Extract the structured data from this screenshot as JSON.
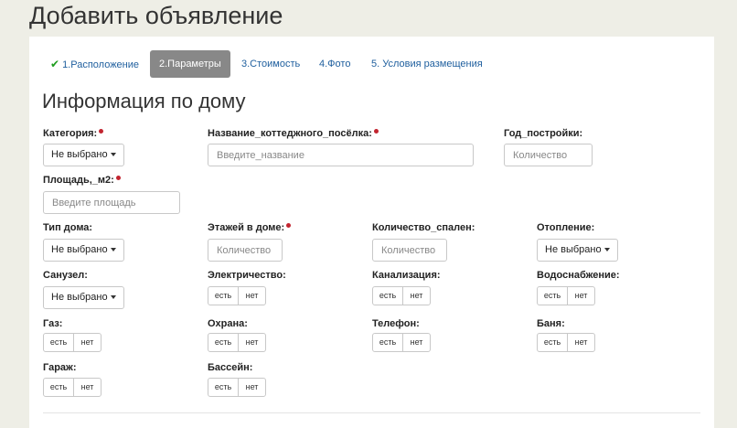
{
  "page_title": "Добавить объявление",
  "tabs": [
    {
      "label": "1.Расположение",
      "done": true
    },
    {
      "label": "2.Параметры",
      "active": true
    },
    {
      "label": "3.Стоимость"
    },
    {
      "label": "4.Фото"
    },
    {
      "label": "5. Условия размещения"
    }
  ],
  "section_title": "Информация по дому",
  "toggle": {
    "yes": "есть",
    "no": "нет"
  },
  "fields": {
    "category": {
      "label": "Категория:",
      "required": true,
      "value": "Не выбрано"
    },
    "settlement_name": {
      "label": "Название_коттеджного_посёлка:",
      "required": true,
      "placeholder": "Введите_название"
    },
    "build_year": {
      "label": "Год_постройки:",
      "placeholder": "Количество"
    },
    "area": {
      "label": "Площадь,_м2:",
      "required": true,
      "placeholder": "Введите площадь"
    },
    "house_type": {
      "label": "Тип дома:",
      "value": "Не выбрано"
    },
    "floors": {
      "label": "Этажей в доме:",
      "required": true,
      "placeholder": "Количество"
    },
    "bedrooms": {
      "label": "Количество_спален:",
      "placeholder": "Количество"
    },
    "heating": {
      "label": "Отопление:",
      "value": "Не выбрано"
    },
    "bathroom": {
      "label": "Санузел:",
      "value": "Не выбрано"
    },
    "electricity": {
      "label": "Электричество:"
    },
    "sewerage": {
      "label": "Канализация:"
    },
    "water": {
      "label": "Водоснабжение:"
    },
    "gas": {
      "label": "Газ:"
    },
    "security": {
      "label": "Охрана:"
    },
    "phone": {
      "label": "Телефон:"
    },
    "sauna": {
      "label": "Баня:"
    },
    "garage": {
      "label": "Гараж:"
    },
    "pool": {
      "label": "Бассейн:"
    }
  }
}
